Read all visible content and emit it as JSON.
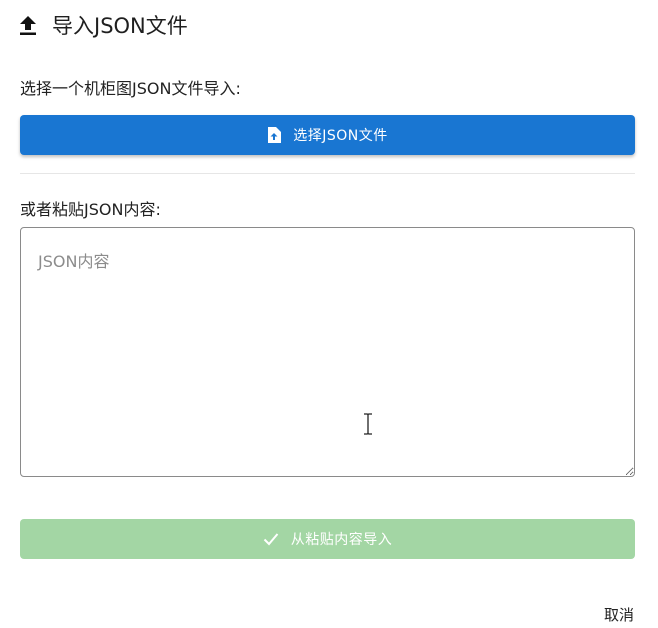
{
  "dialog": {
    "title": "导入JSON文件",
    "title_icon": "upload-icon",
    "select_label": "选择一个机柜图JSON文件导入:",
    "select_button_label": "选择JSON文件",
    "select_button_icon": "file-upload-icon",
    "paste_label": "或者粘贴JSON内容:",
    "textarea_placeholder": "JSON内容",
    "textarea_value": "",
    "import_button_label": "从粘贴内容导入",
    "import_button_icon": "check-icon",
    "cancel_label": "取消"
  },
  "colors": {
    "primary": "#1976d2",
    "success_disabled": "#a3d6a4",
    "text": "#222222",
    "placeholder": "#8c8c8c"
  }
}
